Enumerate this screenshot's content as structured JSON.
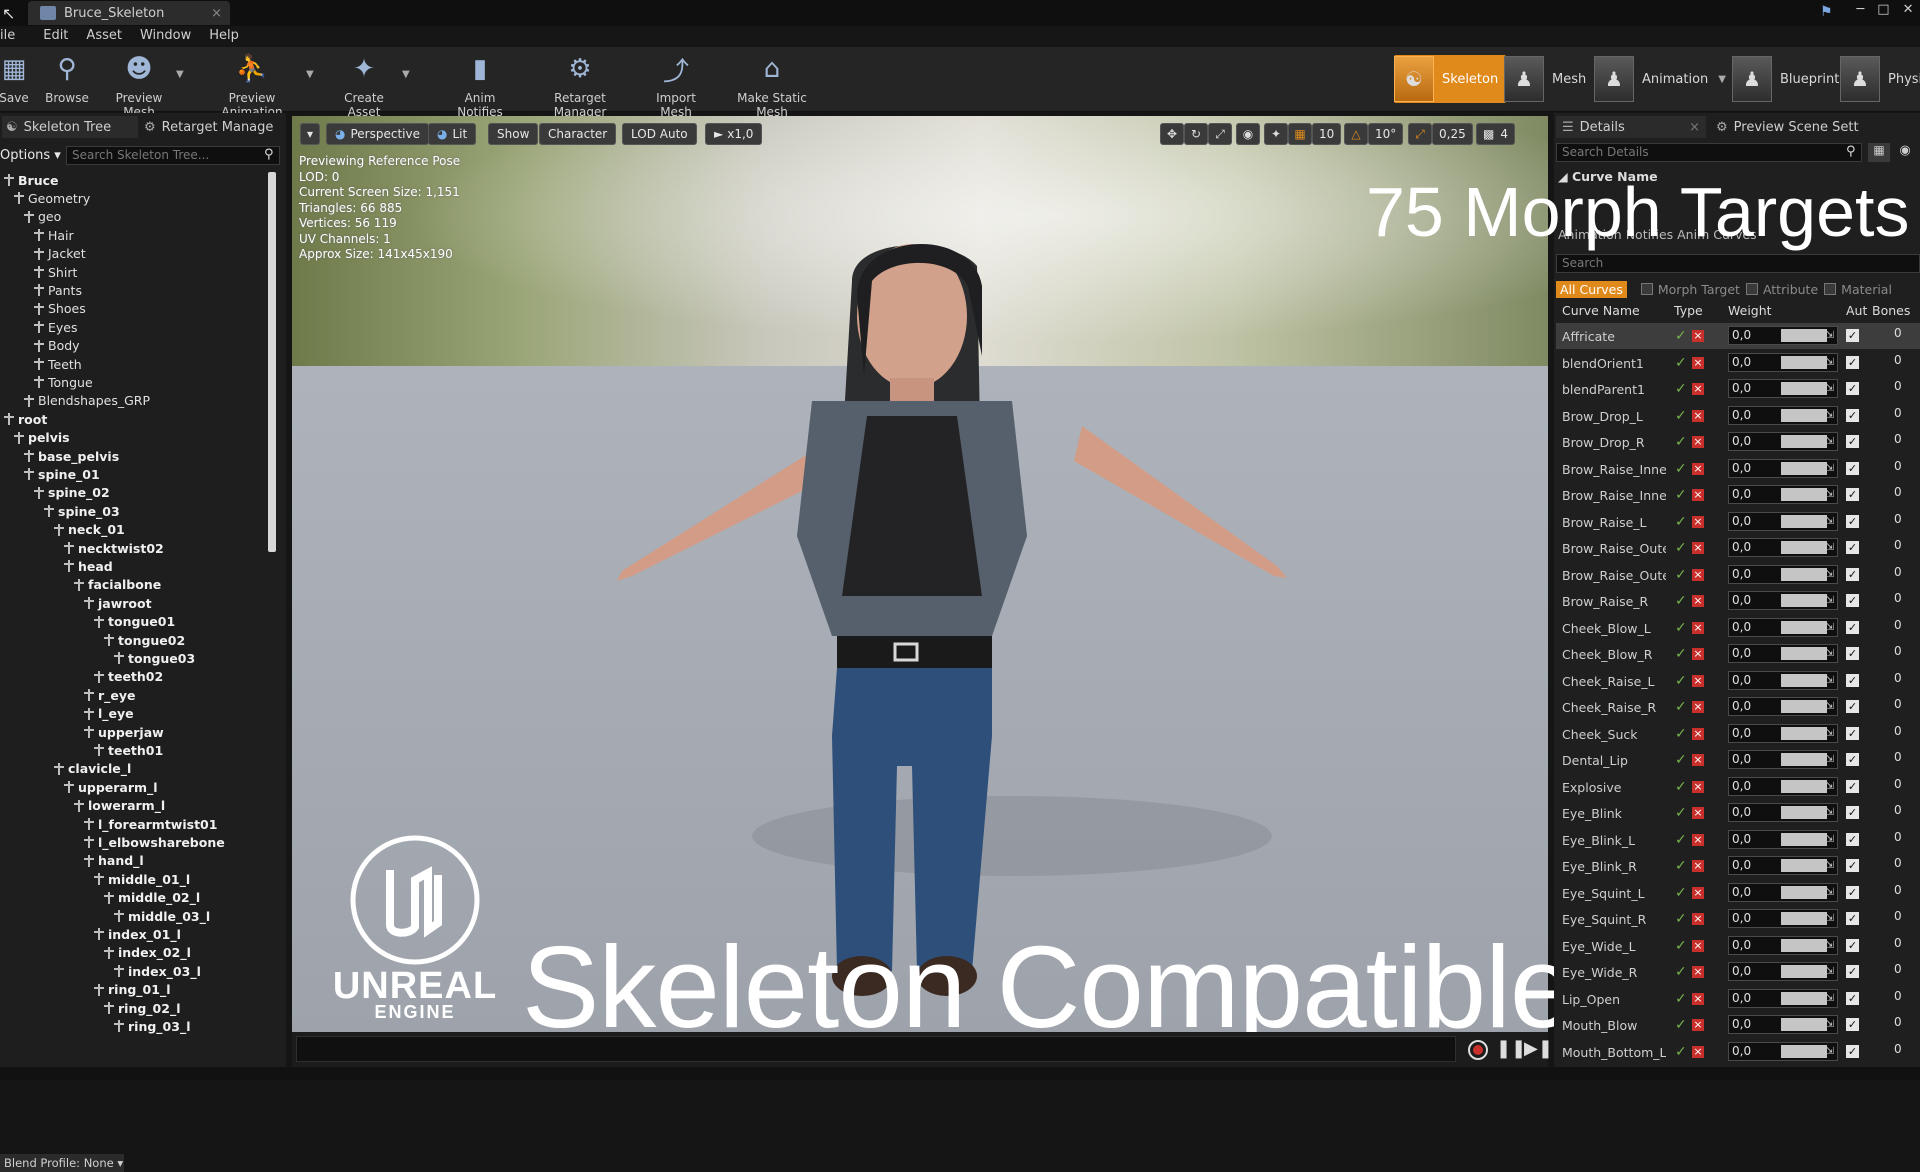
{
  "window": {
    "tab_title": "Bruce_Skeleton",
    "tab_close": "×"
  },
  "menu": [
    "ile",
    "Edit",
    "Asset",
    "Window",
    "Help"
  ],
  "toolbar": {
    "buttons": [
      {
        "label": "Save",
        "icon": "save-icon"
      },
      {
        "label": "Browse",
        "icon": "browse-icon"
      },
      {
        "label": "Preview Mesh",
        "icon": "preview-mesh-icon"
      },
      {
        "label": "Preview Animation",
        "icon": "preview-animation-icon"
      },
      {
        "label": "Create Asset",
        "icon": "create-asset-icon"
      },
      {
        "label": "Anim Notifies",
        "icon": "anim-notifies-icon"
      },
      {
        "label": "Retarget Manager",
        "icon": "retarget-manager-icon"
      },
      {
        "label": "Import Mesh",
        "icon": "import-mesh-icon"
      },
      {
        "label": "Make Static Mesh",
        "icon": "make-static-mesh-icon"
      }
    ],
    "modes": [
      "Skeleton",
      "Mesh",
      "Animation",
      "Blueprint",
      "Physi"
    ],
    "accent": "#e08a1c"
  },
  "left_panel": {
    "tabs": [
      "Skeleton Tree",
      "Retarget Manage"
    ],
    "options_label": "Options",
    "search_placeholder": "Search Skeleton Tree...",
    "tree": [
      {
        "label": "Bruce",
        "bold": true
      },
      {
        "label": "Geometry",
        "bold": false
      },
      {
        "label": "geo",
        "bold": false
      },
      {
        "label": "Hair",
        "bold": false
      },
      {
        "label": "Jacket",
        "bold": false
      },
      {
        "label": "Shirt",
        "bold": false
      },
      {
        "label": "Pants",
        "bold": false
      },
      {
        "label": "Shoes",
        "bold": false
      },
      {
        "label": "Eyes",
        "bold": false
      },
      {
        "label": "Body",
        "bold": false
      },
      {
        "label": "Teeth",
        "bold": false
      },
      {
        "label": "Tongue",
        "bold": false
      },
      {
        "label": "Blendshapes_GRP",
        "bold": false
      },
      {
        "label": "root",
        "bold": true
      },
      {
        "label": "pelvis",
        "bold": true
      },
      {
        "label": "base_pelvis",
        "bold": true
      },
      {
        "label": "spine_01",
        "bold": true
      },
      {
        "label": "spine_02",
        "bold": true
      },
      {
        "label": "spine_03",
        "bold": true
      },
      {
        "label": "neck_01",
        "bold": true
      },
      {
        "label": "necktwist02",
        "bold": true
      },
      {
        "label": "head",
        "bold": true
      },
      {
        "label": "facialbone",
        "bold": true
      },
      {
        "label": "jawroot",
        "bold": true
      },
      {
        "label": "tongue01",
        "bold": true
      },
      {
        "label": "tongue02",
        "bold": true
      },
      {
        "label": "tongue03",
        "bold": true
      },
      {
        "label": "teeth02",
        "bold": true
      },
      {
        "label": "r_eye",
        "bold": true
      },
      {
        "label": "l_eye",
        "bold": true
      },
      {
        "label": "upperjaw",
        "bold": true
      },
      {
        "label": "teeth01",
        "bold": true
      },
      {
        "label": "clavicle_l",
        "bold": true
      },
      {
        "label": "upperarm_l",
        "bold": true
      },
      {
        "label": "lowerarm_l",
        "bold": true
      },
      {
        "label": "l_forearmtwist01",
        "bold": true
      },
      {
        "label": "l_elbowsharebone",
        "bold": true
      },
      {
        "label": "hand_l",
        "bold": true
      },
      {
        "label": "middle_01_l",
        "bold": true
      },
      {
        "label": "middle_02_l",
        "bold": true
      },
      {
        "label": "middle_03_l",
        "bold": true
      },
      {
        "label": "index_01_l",
        "bold": true
      },
      {
        "label": "index_02_l",
        "bold": true
      },
      {
        "label": "index_03_l",
        "bold": true
      },
      {
        "label": "ring_01_l",
        "bold": true
      },
      {
        "label": "ring_02_l",
        "bold": true
      },
      {
        "label": "ring_03_l",
        "bold": true
      }
    ],
    "blend_profile": "Blend Profile: None"
  },
  "viewport": {
    "buttons": {
      "perspective": "Perspective",
      "lit": "Lit",
      "show": "Show",
      "character": "Character",
      "lod": "LOD Auto",
      "speed": "x1,0"
    },
    "right_controls": {
      "grid": "10",
      "angle": "10°",
      "scale": "0,25",
      "camera": "4"
    },
    "info": [
      "Previewing Reference Pose",
      "LOD: 0",
      "Current Screen Size: 1,151",
      "Triangles: 66 885",
      "Vertices: 56 119",
      "UV Channels: 1",
      "Approx Size: 141x45x190"
    ],
    "promo_main": "Skeleton Compatible",
    "promo_morph": "75 Morph Targets",
    "logo_line1": "UNREAL",
    "logo_line2": "ENGINE"
  },
  "right_panel": {
    "tabs": [
      "Details",
      "Preview Scene Sett"
    ],
    "search_placeholder": "Search Details",
    "section": "Curve Name",
    "subtabs": "Animation Notifies   Anim Curves",
    "curve_search": "Search",
    "filters": [
      "All Curves",
      "Morph Target",
      "Attribute",
      "Material"
    ],
    "columns": [
      "Curve Name",
      "Type",
      "Weight",
      "Aut",
      "Bones"
    ],
    "curves": [
      {
        "name": "Affricate",
        "weight": "0,0",
        "bones": "0"
      },
      {
        "name": "blendOrient1",
        "weight": "0,0",
        "bones": "0"
      },
      {
        "name": "blendParent1",
        "weight": "0,0",
        "bones": "0"
      },
      {
        "name": "Brow_Drop_L",
        "weight": "0,0",
        "bones": "0"
      },
      {
        "name": "Brow_Drop_R",
        "weight": "0,0",
        "bones": "0"
      },
      {
        "name": "Brow_Raise_Inner_",
        "weight": "0,0",
        "bones": "0"
      },
      {
        "name": "Brow_Raise_Inner_",
        "weight": "0,0",
        "bones": "0"
      },
      {
        "name": "Brow_Raise_L",
        "weight": "0,0",
        "bones": "0"
      },
      {
        "name": "Brow_Raise_Outer_",
        "weight": "0,0",
        "bones": "0"
      },
      {
        "name": "Brow_Raise_Outer_",
        "weight": "0,0",
        "bones": "0"
      },
      {
        "name": "Brow_Raise_R",
        "weight": "0,0",
        "bones": "0"
      },
      {
        "name": "Cheek_Blow_L",
        "weight": "0,0",
        "bones": "0"
      },
      {
        "name": "Cheek_Blow_R",
        "weight": "0,0",
        "bones": "0"
      },
      {
        "name": "Cheek_Raise_L",
        "weight": "0,0",
        "bones": "0"
      },
      {
        "name": "Cheek_Raise_R",
        "weight": "0,0",
        "bones": "0"
      },
      {
        "name": "Cheek_Suck",
        "weight": "0,0",
        "bones": "0"
      },
      {
        "name": "Dental_Lip",
        "weight": "0,0",
        "bones": "0"
      },
      {
        "name": "Explosive",
        "weight": "0,0",
        "bones": "0"
      },
      {
        "name": "Eye_Blink",
        "weight": "0,0",
        "bones": "0"
      },
      {
        "name": "Eye_Blink_L",
        "weight": "0,0",
        "bones": "0"
      },
      {
        "name": "Eye_Blink_R",
        "weight": "0,0",
        "bones": "0"
      },
      {
        "name": "Eye_Squint_L",
        "weight": "0,0",
        "bones": "0"
      },
      {
        "name": "Eye_Squint_R",
        "weight": "0,0",
        "bones": "0"
      },
      {
        "name": "Eye_Wide_L",
        "weight": "0,0",
        "bones": "0"
      },
      {
        "name": "Eye_Wide_R",
        "weight": "0,0",
        "bones": "0"
      },
      {
        "name": "Lip_Open",
        "weight": "0,0",
        "bones": "0"
      },
      {
        "name": "Mouth_Blow",
        "weight": "0,0",
        "bones": "0"
      },
      {
        "name": "Mouth_Bottom_Lip",
        "weight": "0,0",
        "bones": "0"
      }
    ]
  }
}
